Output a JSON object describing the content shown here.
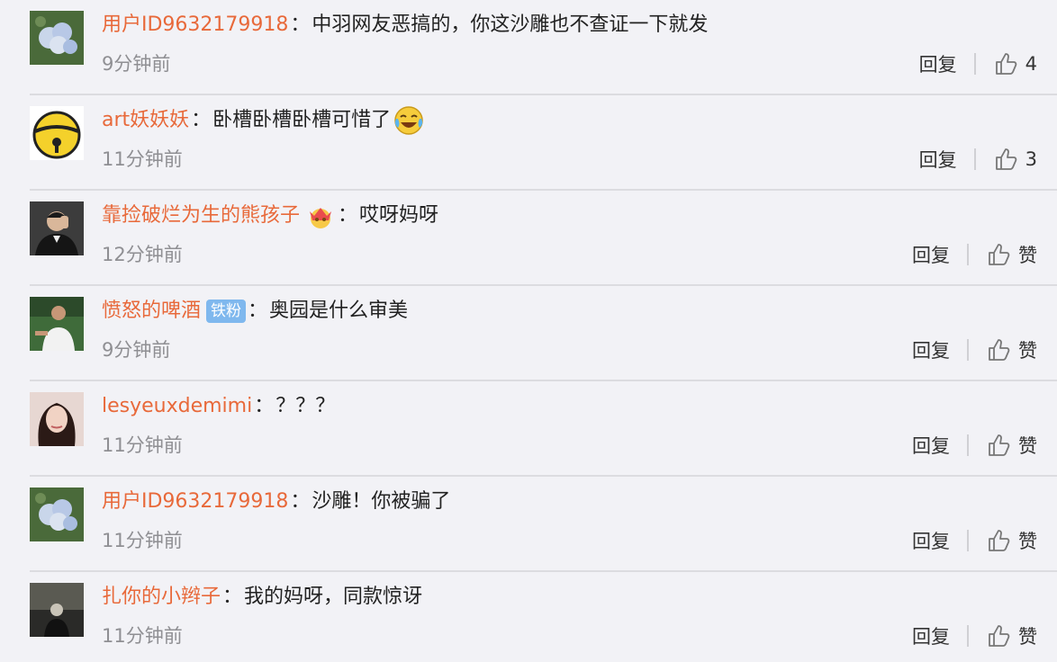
{
  "comments": [
    {
      "user": "用户ID9632179918",
      "text": "中羽网友恶搞的，你这沙雕也不查证一下就发",
      "time": "9分钟前",
      "reply": "回复",
      "likes": "4",
      "avatar": "hydrangea-avatar"
    },
    {
      "user": "art妖妖妖",
      "text": "卧槽卧槽卧槽可惜了",
      "time": "11分钟前",
      "reply": "回复",
      "likes": "3",
      "avatar": "yellow-bell-avatar",
      "emoji": "laugh-cry-emoji"
    },
    {
      "user": "靠捡破烂为生的熊孩子",
      "text": "哎呀妈呀",
      "time": "12分钟前",
      "reply": "回复",
      "likes": "赞",
      "avatar": "man-in-suit-avatar",
      "badge": "vip-crown-icon"
    },
    {
      "user": "愤怒的啤酒",
      "text": "奥园是什么审美",
      "time": "9分钟前",
      "reply": "回复",
      "likes": "赞",
      "avatar": "tennis-player-avatar",
      "fan_badge": "铁粉"
    },
    {
      "user": "lesyeuxdemimi",
      "text": "？？？",
      "time": "11分钟前",
      "reply": "回复",
      "likes": "赞",
      "avatar": "woman-portrait-avatar"
    },
    {
      "user": "用户ID9632179918",
      "text": "沙雕！你被骗了",
      "time": "11分钟前",
      "reply": "回复",
      "likes": "赞",
      "avatar": "hydrangea-avatar"
    },
    {
      "user": "扎你的小辫子",
      "text": "我的妈呀，同款惊讶",
      "time": "11分钟前",
      "reply": "回复",
      "likes": "赞",
      "avatar": "dark-figure-avatar"
    }
  ],
  "separator": "："
}
